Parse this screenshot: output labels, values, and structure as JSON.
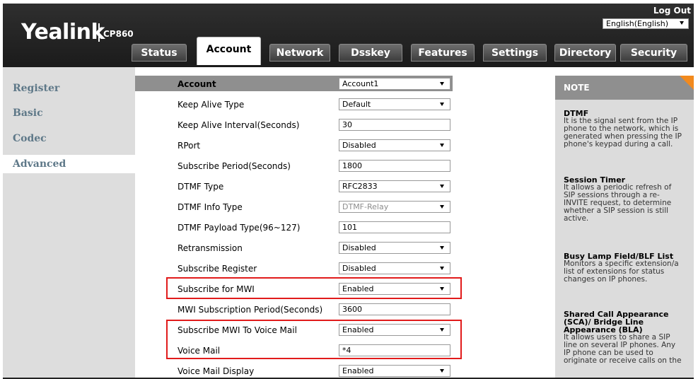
{
  "header": {
    "brand": "Yealink",
    "model": "CP860",
    "logout_label": "Log Out",
    "language": "English(English)"
  },
  "tabs": [
    "Status",
    "Account",
    "Network",
    "Dsskey",
    "Features",
    "Settings",
    "Directory",
    "Security"
  ],
  "active_tab": "Account",
  "sidebar": {
    "items": [
      "Register",
      "Basic",
      "Codec",
      "Advanced"
    ],
    "active": "Advanced"
  },
  "form": {
    "account": {
      "label": "Account",
      "value": "Account1"
    },
    "keep_alive_type": {
      "label": "Keep Alive Type",
      "value": "Default"
    },
    "keep_alive_interval": {
      "label": "Keep Alive Interval(Seconds)",
      "value": "30"
    },
    "rport": {
      "label": "RPort",
      "value": "Disabled"
    },
    "subscribe_period": {
      "label": "Subscribe Period(Seconds)",
      "value": "1800"
    },
    "dtmf_type": {
      "label": "DTMF Type",
      "value": "RFC2833"
    },
    "dtmf_info_type": {
      "label": "DTMF Info Type",
      "value": "DTMF-Relay"
    },
    "dtmf_payload": {
      "label": "DTMF Payload Type(96~127)",
      "value": "101"
    },
    "retransmission": {
      "label": "Retransmission",
      "value": "Disabled"
    },
    "subscribe_register": {
      "label": "Subscribe Register",
      "value": "Disabled"
    },
    "subscribe_mwi": {
      "label": "Subscribe for MWI",
      "value": "Enabled"
    },
    "mwi_period": {
      "label": "MWI Subscription Period(Seconds)",
      "value": "3600"
    },
    "subscribe_mwi_vm": {
      "label": "Subscribe MWI To Voice Mail",
      "value": "Enabled"
    },
    "voice_mail": {
      "label": "Voice Mail",
      "value": "*4"
    },
    "voice_mail_display": {
      "label": "Voice Mail Display",
      "value": "Enabled"
    }
  },
  "note": {
    "title": "NOTE",
    "sections": [
      {
        "heading": "DTMF",
        "lines": [
          "It is the signal sent from the IP",
          "phone to the network, which is",
          "generated when pressing the IP",
          "phone's keypad during a call."
        ]
      },
      {
        "heading": "Session Timer",
        "lines": [
          "It allows a periodic refresh of",
          "SIP sessions through a re-",
          "INVITE request, to determine",
          "whether a SIP session is still",
          "active."
        ]
      },
      {
        "heading": "Busy Lamp Field/BLF List",
        "lines": [
          "Monitors a specific extension/a",
          "list of extensions for status",
          "changes on IP phones."
        ]
      },
      {
        "heading_lines": [
          "Shared Call Appearance",
          "(SCA)/ Bridge Line",
          "Appearance (BLA)"
        ],
        "lines": [
          "It allows users to share a SIP",
          "line on several IP phones. Any",
          "IP phone can be used to",
          "originate or receive calls on the"
        ]
      }
    ]
  },
  "colors": {
    "header_bg": "#222222",
    "sidebar_bg": "#dddddd",
    "sidebar_text": "#5e7888",
    "highlight_border": "#e11b1b",
    "note_accent": "#f28a1e"
  }
}
